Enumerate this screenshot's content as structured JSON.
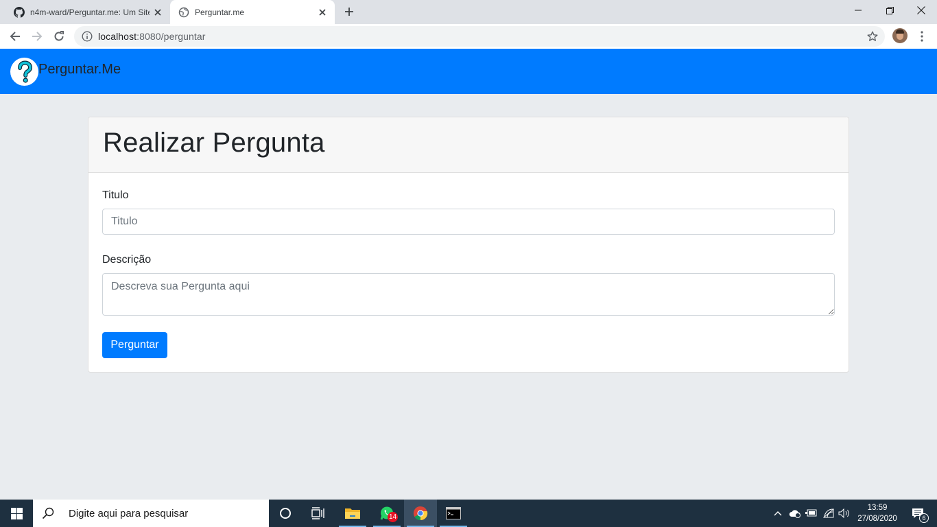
{
  "browser": {
    "tabs": [
      {
        "title": "n4m-ward/Perguntar.me: Um Site",
        "icon": "github-icon",
        "active": false
      },
      {
        "title": "Perguntar.me",
        "icon": "globe-icon",
        "active": true
      }
    ],
    "address": {
      "host": "localhost",
      "path": ":8080/perguntar"
    }
  },
  "navbar": {
    "brand": "Perguntar.Me",
    "logo_icon": "question-mark-icon",
    "color": "#007bff"
  },
  "form": {
    "heading": "Realizar Pergunta",
    "title_label": "Titulo",
    "title_placeholder": "Titulo",
    "title_value": "",
    "description_label": "Descrição",
    "description_placeholder": "Descreva sua Pergunta aqui",
    "description_value": "",
    "submit_label": "Perguntar"
  },
  "taskbar": {
    "search_placeholder": "Digite aqui para pesquisar",
    "whatsapp_badge": "14",
    "time": "13:59",
    "date": "27/08/2020",
    "notifications": "6"
  }
}
